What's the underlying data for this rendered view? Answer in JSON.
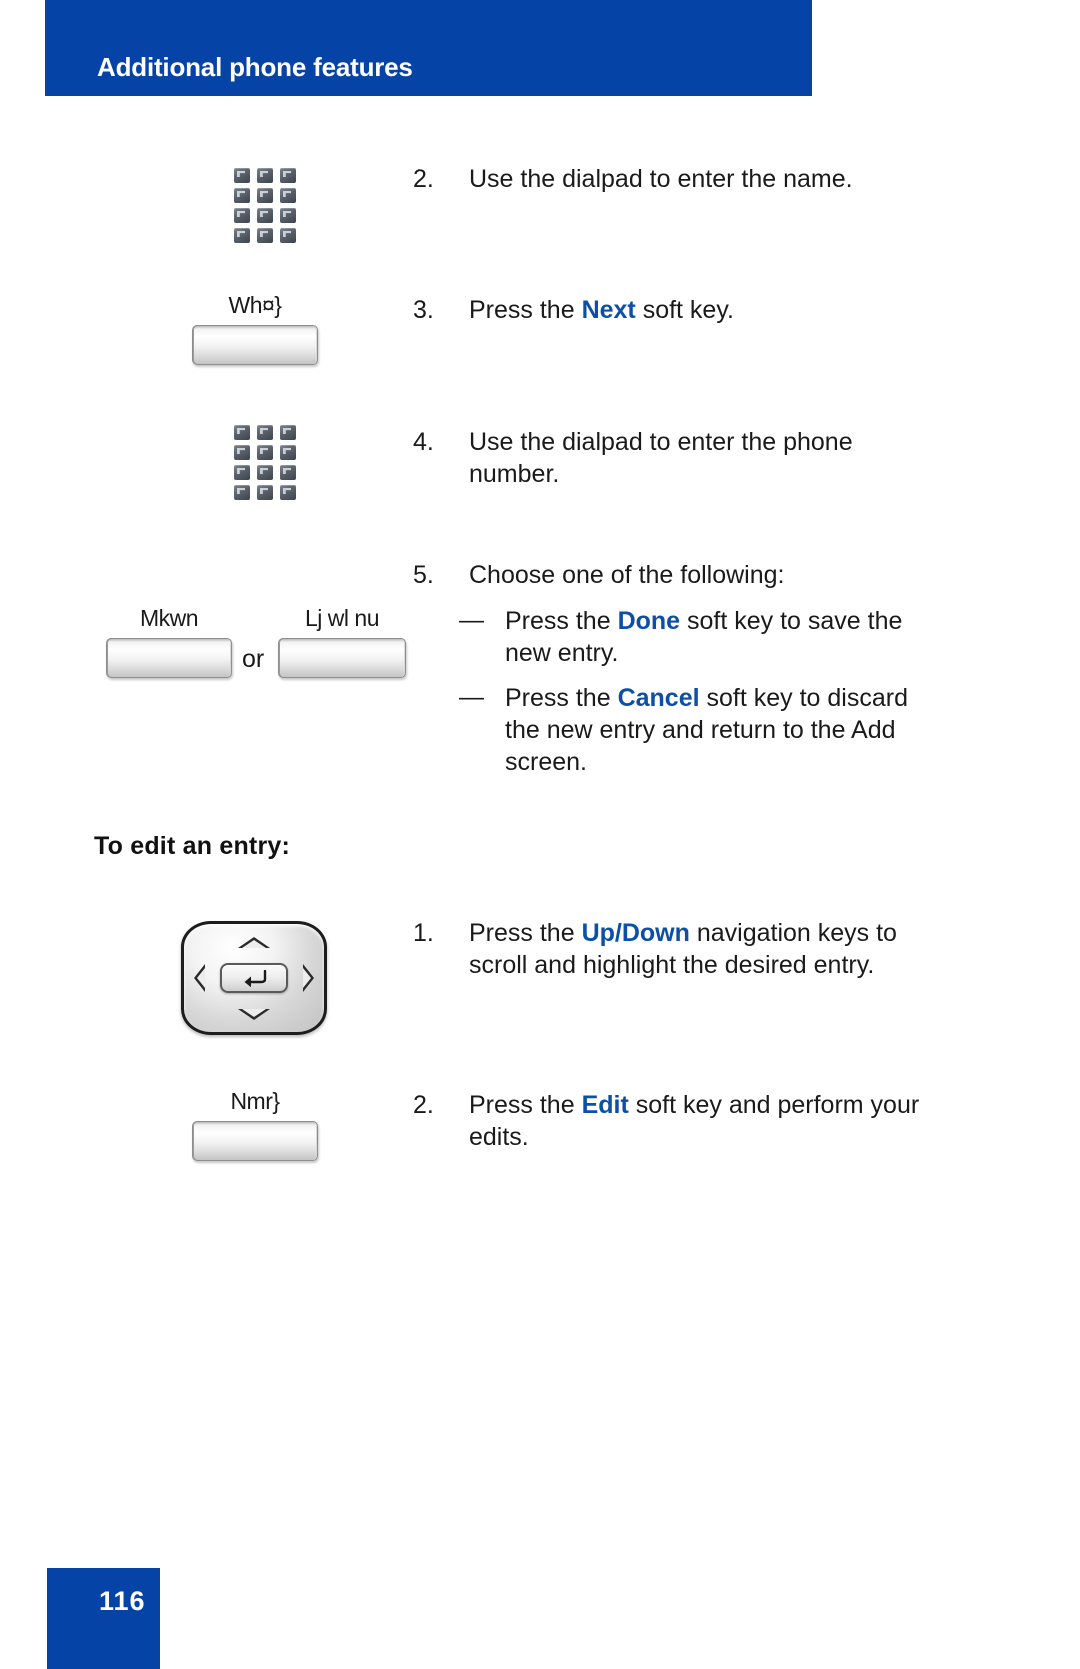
{
  "header": {
    "title": "Additional phone features",
    "bg_color": "#0543a6"
  },
  "footer": {
    "page_number": "116",
    "bg_color": "#0543a6"
  },
  "accent_color": "#0d4fa8",
  "connector": {
    "or_label": "or"
  },
  "icons": {
    "dialpad_1": "dialpad-icon",
    "dialpad_2": "dialpad-icon",
    "navigation_cluster": "navigation-keys-icon",
    "enter_key": "enter-arrow-icon",
    "nav_up": "triangle-up-icon",
    "nav_down": "triangle-down-icon",
    "nav_left": "triangle-left-icon",
    "nav_right": "triangle-right-icon"
  },
  "softkeys": {
    "next": {
      "label": "Wh¤}",
      "meaning": "Next"
    },
    "done": {
      "label": "Mkwn",
      "meaning": "Done"
    },
    "cancel": {
      "label": "Lj wl nu",
      "meaning": "Cancel"
    },
    "edit": {
      "label": "Nmr}",
      "meaning": "Edit"
    }
  },
  "steps": {
    "step2": {
      "num": "2.",
      "text": "Use the dialpad to enter the name."
    },
    "step3": {
      "num": "3.",
      "pre": "Press the ",
      "keyword": "Next",
      "post": " soft key."
    },
    "step4": {
      "num": "4.",
      "text": "Use the dialpad to enter the phone number."
    },
    "step5": {
      "num": "5.",
      "text": "Choose one of the following:"
    },
    "bullet_done": {
      "dash": "—",
      "pre": "Press the ",
      "keyword": "Done",
      "post": " soft key to save the new entry."
    },
    "bullet_cancel": {
      "dash": "—",
      "pre": "Press the ",
      "keyword": "Cancel",
      "post": " soft key to discard the new entry and return to the Add screen."
    }
  },
  "edit_section": {
    "heading": "To edit an entry:",
    "step1": {
      "num": "1.",
      "pre": "Press the ",
      "keyword_up": "Up",
      "separator": "/",
      "keyword_down": "Down",
      "post": " navigation keys to scroll and highlight the desired entry."
    },
    "step2": {
      "num": "2.",
      "pre": "Press the ",
      "keyword": "Edit",
      "post": " soft key and perform your edits."
    }
  }
}
